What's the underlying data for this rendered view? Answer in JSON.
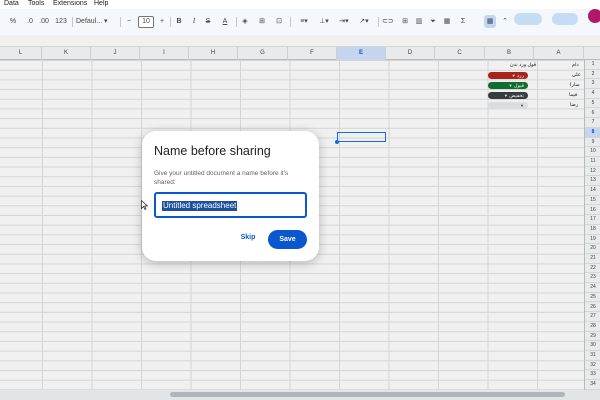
{
  "menu": {
    "items": [
      "Data",
      "Tools",
      "Extensions",
      "Help"
    ]
  },
  "toolbar": {
    "percent": "%",
    "decrease_decimal": ".0",
    "increase_decimal": ".00",
    "number_format": "123",
    "font": "Defaul...",
    "minus": "−",
    "font_size": "10",
    "plus": "+",
    "bold": "B",
    "italic": "I",
    "text_color": "A"
  },
  "columns": [
    "L",
    "K",
    "J",
    "I",
    "H",
    "G",
    "F",
    "E",
    "D",
    "C",
    "B",
    "A"
  ],
  "selected_column": "E",
  "rows": [
    "1",
    "2",
    "3",
    "4",
    "5",
    "6",
    "7",
    "8",
    "9",
    "10",
    "11",
    "12",
    "13",
    "14",
    "15",
    "16",
    "17",
    "18",
    "19",
    "20",
    "21",
    "22",
    "23",
    "24",
    "25",
    "26",
    "27",
    "28",
    "29",
    "30",
    "31",
    "32",
    "33",
    "34"
  ],
  "selected_row": "8",
  "cells": {
    "b1": "قول ورد ندن",
    "a1": "دام",
    "a2": "علي",
    "a3": "سارا",
    "a4": "فيما",
    "a5": "رضا",
    "chips": [
      {
        "label": "ررد",
        "color": "#b3261e"
      },
      {
        "label": "قبول",
        "color": "#137333"
      },
      {
        "label": "تخفيض",
        "color": "#3c4043"
      },
      {
        "label": "",
        "color": "#e8eaed"
      }
    ]
  },
  "dialog": {
    "title": "Name before sharing",
    "description": "Give your untitled document a name before it's shared:",
    "input_value": "Untitled spreadsheet",
    "skip_label": "Skip",
    "save_label": "Save"
  }
}
